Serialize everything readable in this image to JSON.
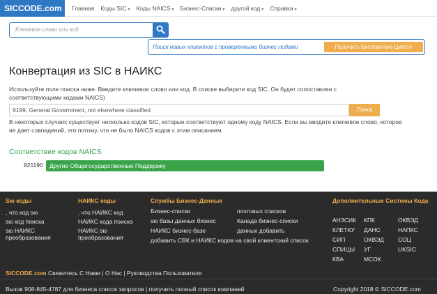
{
  "nav": {
    "logo": "SICCODE.com",
    "items": [
      {
        "label": "Главная",
        "caret": false
      },
      {
        "label": "Коды SIC",
        "caret": true
      },
      {
        "label": "Коды NAICS",
        "caret": true
      },
      {
        "label": "Бизнес-Списки",
        "caret": true
      },
      {
        "label": "другой код",
        "caret": true
      },
      {
        "label": "Справка",
        "caret": true
      }
    ],
    "caret_glyph": "▾"
  },
  "search": {
    "placeholder": "Ключевое слово или код",
    "icon": "search-icon"
  },
  "promo": {
    "text": "Поиск новых клиентов с проверенными бизнес-лидами",
    "button": "Получить Бесплатную Цитату"
  },
  "main": {
    "title": "Конвертация из SIC в НАИКС",
    "intro": "Используйте поле поиска ниже. Введите ключевое слово или код. В списке выберите код SIC. Он будет сопоставлен с соответствующими кодами NAICS)",
    "code_input_value": "9199, General Government, not elsewhere classified",
    "code_button": "Поиск",
    "note": "В некоторых случаях существует несколько кодов SIC, которые соответствуют одному коду NAICS. Если вы вводите ключевое слово, которое не дает совпадений, это потому, что не было NAICS кодов с этим описанием.",
    "match_heading": "Соответствие кодов NAICS",
    "match": {
      "code": "921190",
      "label": "Другие Общегосударственные Поддержку"
    }
  },
  "footer": {
    "col1": {
      "heading": "Sю коды",
      "links": [
        ", что код sю",
        "sю код поиска",
        "sю НАИКС преобразования"
      ]
    },
    "col2": {
      "heading": "НАИКС коды",
      "links": [
        ", что НАИКС код",
        "НАИКС кода поиска",
        "НАИКС sю преобразования"
      ]
    },
    "col3": {
      "heading": "Службы Бизнес-Данных",
      "links": [
        "Бизнес-списки",
        "почтовых списков",
        "sю базы данных бизнес",
        "Канада бизнес-списки",
        "НАИКС бизнес-базе",
        "данных добавить",
        "добавить СВК и НАИКС кодов на свой клиентский список"
      ]
    },
    "col4": {
      "heading": "Дополнительные Системы Кода",
      "links": [
        "АНЗСИК",
        "КПК",
        "ОКВЭД",
        "КЛЕТКУ",
        "ДАНС",
        "НАПКС",
        "СИП",
        "ОКВЭД",
        "СОЦ",
        "СПИЦЫ",
        "УГ",
        "UKSIC",
        "КВА",
        "МСОК"
      ]
    },
    "bar": {
      "brand": "SICCODE.com",
      "rest": " Свяжитесь С Нами | О Нас | Руководства Пользователя"
    },
    "bottom": "Вызов 908-845-4787 для бизнеса список запросов | получить полный список компаний",
    "copyright": "Copyright 2018 © SICCODE.com"
  },
  "colors": {
    "brand_blue": "#2f78c4",
    "accent_orange": "#f0ad4e",
    "match_green": "#3aa34a",
    "footer_bg": "#2b2b2b"
  }
}
